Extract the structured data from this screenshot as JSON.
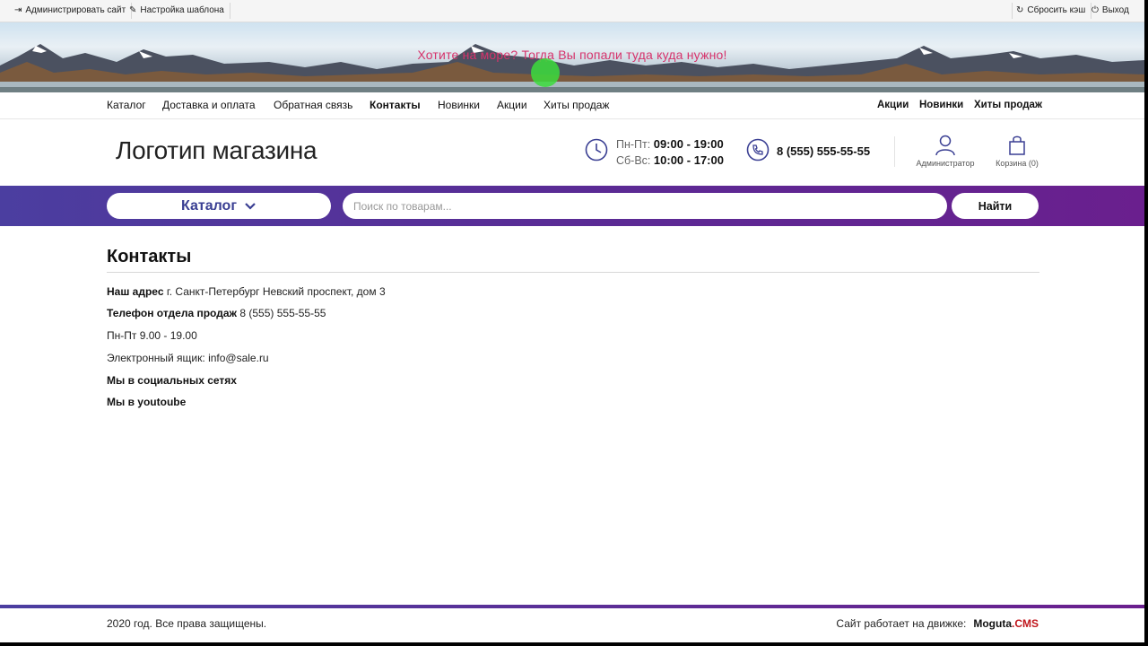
{
  "admin_bar": {
    "administer_site": "Администрировать сайт",
    "template_settings": "Настройка шаблона",
    "reset_cache": "Сбросить кэш",
    "logout": "Выход"
  },
  "banner": {
    "text": "Хотите на море? Тогда Вы попали туда куда нужно!"
  },
  "top_nav": {
    "left": [
      "Каталог",
      "Доставка и оплата",
      "Обратная связь",
      "Контакты",
      "Новинки",
      "Акции",
      "Хиты продаж"
    ],
    "active": "Контакты",
    "right": [
      "Акции",
      "Новинки",
      "Хиты продаж"
    ]
  },
  "header": {
    "logo": "Логотип магазина",
    "weekdays_label": "Пн-Пт:",
    "weekdays_hours": "09:00 - 19:00",
    "weekend_label": "Сб-Вс:",
    "weekend_hours": "10:00 - 17:00",
    "phone": "8 (555) 555-55-55",
    "account_label": "Администратор",
    "cart_label": "Корзина (0)"
  },
  "search": {
    "catalog_label": "Каталог",
    "placeholder": "Поиск по товарам...",
    "button": "Найти"
  },
  "content": {
    "title": "Контакты",
    "address_label": "Наш адрес",
    "address_value": "г. Санкт-Петербург Невский проспект, дом 3",
    "sales_phone_label": "Телефон отдела продаж",
    "sales_phone_value": "8 (555) 555-55-55",
    "work_hours": "Пн-Пт 9.00 - 19.00",
    "email_label": "Электронный ящик:",
    "email_value": "info@sale.ru",
    "social": "Мы в социальных сетях",
    "youtube": "Мы в youtoube"
  },
  "footer": {
    "copyright": "2020 год. Все права защищены.",
    "engine_label": "Сайт работает на движке:",
    "brand_main": "Moguta",
    "brand_suffix": ".CMS"
  },
  "colors": {
    "accent_purple": "#5a2b95",
    "banner_text": "#d6336c",
    "brand_red": "#c0161c",
    "catalog_text": "#3a3f93"
  }
}
